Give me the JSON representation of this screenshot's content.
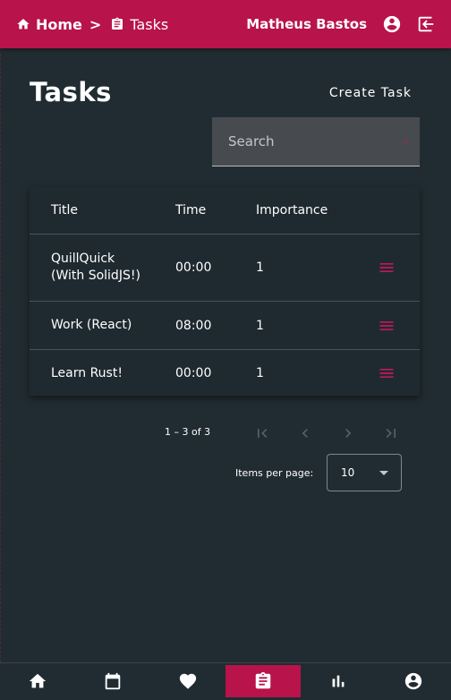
{
  "header": {
    "breadcrumb_home": "Home",
    "breadcrumb_sep": ">",
    "breadcrumb_current": "Tasks",
    "user_name": "Matheus Bastos",
    "accent": "#b8134a"
  },
  "page": {
    "title": "Tasks",
    "create_label": "Create Task",
    "search_placeholder": "Search"
  },
  "table": {
    "headers": {
      "title": "Title",
      "time": "Time",
      "importance": "Importance"
    },
    "rows": [
      {
        "title": "QuillQuick\n(With SolidJS!)",
        "time": "00:00",
        "importance": "1"
      },
      {
        "title": "Work (React)",
        "time": "08:00",
        "importance": "1"
      },
      {
        "title": "Learn Rust!",
        "time": "00:00",
        "importance": "1"
      }
    ]
  },
  "pagination": {
    "range": "1 – 3 of 3",
    "items_per_page_label": "Items per page:",
    "items_per_page_value": "10"
  },
  "bottom_nav": {
    "items": [
      "home-icon",
      "calendar-icon",
      "heart-icon",
      "clipboard-icon",
      "bar-chart-icon",
      "account-icon"
    ],
    "active": "clipboard-icon"
  }
}
